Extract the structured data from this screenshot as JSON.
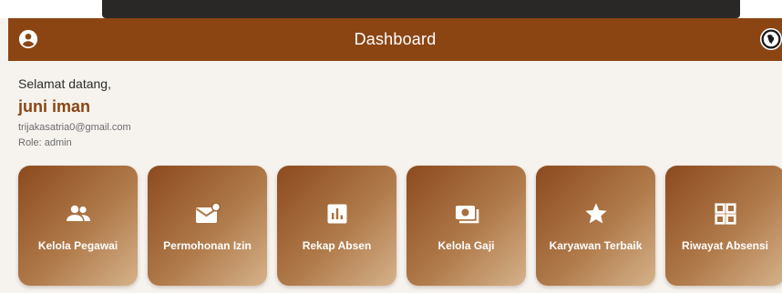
{
  "appbar": {
    "title": "Dashboard",
    "left_icon": "account-circle-icon",
    "right_icon": "logo-icon"
  },
  "profile": {
    "greeting": "Selamat datang,",
    "name": "juni iman",
    "email": "trijakasatria0@gmail.com",
    "role": "Role: admin"
  },
  "menu": [
    {
      "label": "Kelola Pegawai",
      "icon": "people-icon"
    },
    {
      "label": "Permohonan Izin",
      "icon": "mail-badge-icon"
    },
    {
      "label": "Rekap Absen",
      "icon": "bar-chart-icon"
    },
    {
      "label": "Kelola Gaji",
      "icon": "money-icon"
    },
    {
      "label": "Karyawan Terbaik",
      "icon": "star-icon"
    },
    {
      "label": "Riwayat Absensi",
      "icon": "grid-icon"
    }
  ],
  "colors": {
    "primary": "#8b4513",
    "background": "#f6f3ef",
    "card_gradient_start": "#8c4a1e",
    "card_gradient_end": "#d5b28a"
  }
}
